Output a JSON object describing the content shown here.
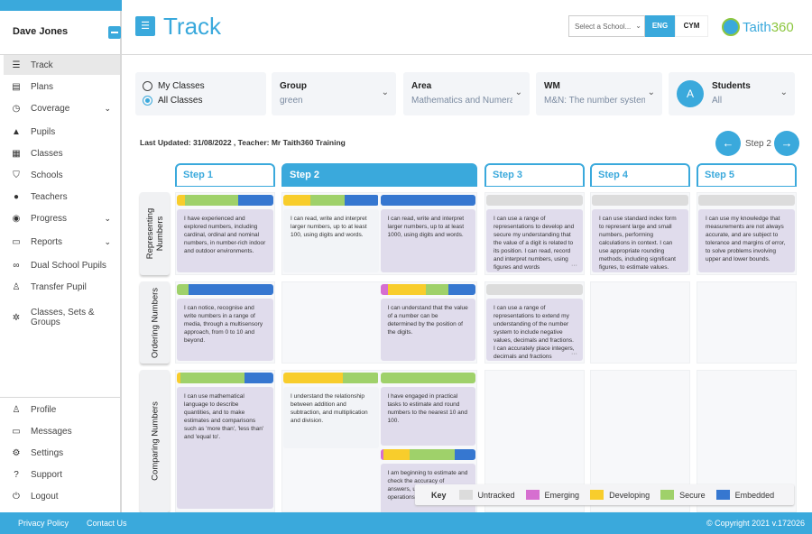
{
  "user": {
    "name": "Dave Jones"
  },
  "sidebar": {
    "items": [
      {
        "label": "Track",
        "icon": "track-icon",
        "glyph": "☰",
        "active": true
      },
      {
        "label": "Plans",
        "icon": "clipboard-icon",
        "glyph": "▤"
      },
      {
        "label": "Coverage",
        "icon": "history-icon",
        "glyph": "◷",
        "chevron": true
      },
      {
        "label": "Pupils",
        "icon": "graduation-cap-icon",
        "glyph": "▲"
      },
      {
        "label": "Classes",
        "icon": "classroom-icon",
        "glyph": "▦"
      },
      {
        "label": "Schools",
        "icon": "shield-icon",
        "glyph": "⛉"
      },
      {
        "label": "Teachers",
        "icon": "people-icon",
        "glyph": "●"
      },
      {
        "label": "Progress",
        "icon": "progress-icon",
        "glyph": "◉",
        "chevron": true
      },
      {
        "label": "Reports",
        "icon": "window-icon",
        "glyph": "▭",
        "chevron": true
      },
      {
        "label": "Dual School Pupils",
        "icon": "link-icon",
        "glyph": "∞"
      },
      {
        "label": "Transfer Pupil",
        "icon": "walking-icon",
        "glyph": "♙"
      },
      {
        "label": "Classes, Sets & Groups",
        "icon": "groups-icon",
        "glyph": "✲"
      }
    ],
    "bottom": [
      {
        "label": "Profile",
        "icon": "person-icon",
        "glyph": "♙"
      },
      {
        "label": "Messages",
        "icon": "message-icon",
        "glyph": "▭"
      },
      {
        "label": "Settings",
        "icon": "gear-icon",
        "glyph": "⚙"
      },
      {
        "label": "Support",
        "icon": "help-icon",
        "glyph": "?"
      },
      {
        "label": "Logout",
        "icon": "power-icon",
        "glyph": "⏻"
      }
    ]
  },
  "header": {
    "title": "Track",
    "school_placeholder": "Select a School...",
    "lang_eng": "ENG",
    "lang_cym": "CYM",
    "logo_a": "Taith",
    "logo_b": "360"
  },
  "filters": {
    "my_classes": "My Classes",
    "all_classes": "All Classes",
    "selected": "All Classes",
    "group": {
      "label": "Group",
      "value": "green"
    },
    "area": {
      "label": "Area",
      "value": "Mathematics and Numeracy"
    },
    "wm": {
      "label": "WM",
      "value": "M&N: The number system is"
    },
    "students": {
      "label": "Students",
      "value": "All",
      "avatar": "A"
    }
  },
  "status": {
    "last_updated": "Last Updated: 31/08/2022 , Teacher: Mr Taith360 Training",
    "current_step": "Step 2"
  },
  "steps": [
    "Step 1",
    "Step 2",
    "Step 3",
    "Step 4",
    "Step 5"
  ],
  "active_step": "Step 2",
  "colors": {
    "untracked": "#dcdcdc",
    "emerging": "#d66fd0",
    "developing": "#f8cd2c",
    "secure": "#9fd16a",
    "embedded": "#3677d0",
    "accent": "#3aa9dc"
  },
  "rows": [
    {
      "label": "Representing Numbers",
      "cells": [
        [
          [
            {
              "bar": {
                "developing": 8,
                "secure": 56,
                "embedded": 36
              },
              "text": "I have experienced and explored numbers, including cardinal, ordinal and nominal numbers, in number-rich indoor and outdoor environments."
            }
          ]
        ],
        [
          [
            {
              "bar": {
                "developing": 28,
                "secure": 36,
                "embedded": 36
              },
              "text": "I can read, write and interpret larger numbers, up to at least 100, using digits and words.",
              "plain": true
            }
          ],
          [
            {
              "bar": {
                "embedded": 100
              },
              "text": "I can read, write and interpret larger numbers, up to at least 1000, using digits and words."
            }
          ]
        ],
        [
          [
            {
              "bar": {
                "untracked": 100
              },
              "text": "I can use a range of representations to develop and secure my understanding that the value of a digit is related to its position. I can read, record and interpret numbers, using figures and words",
              "more": true
            }
          ]
        ],
        [
          [
            {
              "bar": {
                "untracked": 100
              },
              "text": "I can use standard index form to represent large and small numbers, performing calculations in context. I can use appropriate rounding methods, including significant figures, to estimate values."
            }
          ]
        ],
        [
          [
            {
              "bar": {
                "untracked": 100
              },
              "text": "I can use my knowledge that measurements are not always accurate, and are subject to tolerance and margins of error, to solve problems involving upper and lower bounds."
            }
          ]
        ]
      ]
    },
    {
      "label": "Ordering Numbers",
      "cells": [
        [
          [
            {
              "bar": {
                "secure": 12,
                "embedded": 88
              },
              "text": "I can notice, recognise and write numbers in a range of media, through a multisensory approach, from 0 to 10 and beyond."
            }
          ]
        ],
        [
          [],
          [
            {
              "bar": {
                "emerging": 8,
                "developing": 40,
                "secure": 24,
                "embedded": 28
              },
              "text": "I can understand that the value of a number can be determined by the position of the digits."
            }
          ]
        ],
        [
          [
            {
              "bar": {
                "untracked": 100
              },
              "text": "I can use a range of representations to extend my understanding of the number system to include negative values, decimals and fractions. I can accurately place integers, decimals and fractions",
              "more": true
            }
          ]
        ],
        [
          []
        ],
        [
          []
        ]
      ]
    },
    {
      "label": "Comparing Numbers",
      "cells": [
        [
          [
            {
              "bar": {
                "developing": 4,
                "secure": 66,
                "embedded": 30
              },
              "text": "I can use mathematical language to describe quantities, and to make estimates and comparisons such as 'more than', 'less than' and 'equal to'."
            }
          ]
        ],
        [
          [
            {
              "bar": {
                "developing": 63,
                "secure": 37
              },
              "text": "I understand the relationship between addition and subtraction, and multiplication and division.",
              "plain": true
            }
          ],
          [
            {
              "bar": {
                "secure": 100
              },
              "text": "I have engaged in practical tasks to estimate and round numbers to the nearest 10 and 100."
            },
            {
              "bar": {
                "emerging": 3,
                "developing": 28,
                "secure": 47,
                "embedded": 22
              },
              "text": "I am beginning to estimate and check the accuracy of answers, using inverse operations"
            }
          ]
        ],
        [
          []
        ],
        [
          []
        ],
        [
          []
        ]
      ]
    }
  ],
  "key": {
    "title": "Key",
    "items": [
      {
        "id": "untracked",
        "label": "Untracked"
      },
      {
        "id": "emerging",
        "label": "Emerging"
      },
      {
        "id": "developing",
        "label": "Developing"
      },
      {
        "id": "secure",
        "label": "Secure"
      },
      {
        "id": "embedded",
        "label": "Embedded"
      }
    ]
  },
  "footer": {
    "privacy": "Privacy Policy",
    "contact": "Contact Us",
    "copyright": "© Copyright 2021 v.172026"
  }
}
